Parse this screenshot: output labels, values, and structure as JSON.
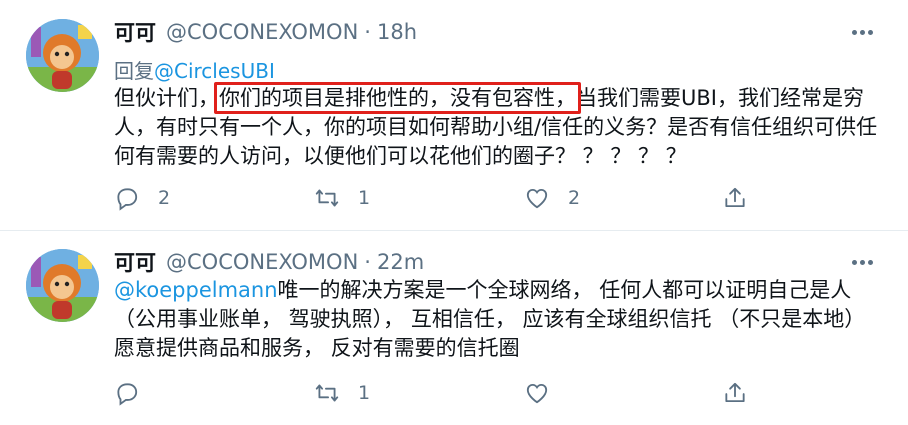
{
  "tweets": [
    {
      "name": "可可",
      "handle": "@COCONEXOMON",
      "separator": "·",
      "time": "18h",
      "reply_prefix": "回复",
      "reply_to": "@CirclesUBI",
      "text_before": "但伙计们，",
      "text_highlight": "你们的项目是排他性的，没有包容性，",
      "text_after": "当我们需要UBI，我们经常是穷人，有时只有一个人，你的项目如何帮助小组/信任的义务？是否有信任组织可供任何有需要的人访问，以便他们可以花他们的圈子？ ？ ？ ？ ？",
      "counts": {
        "reply": "2",
        "retweet": "1",
        "like": "2"
      }
    },
    {
      "name": "可可",
      "handle": "@COCONEXOMON",
      "separator": "·",
      "time": "22m",
      "mention": "@koeppelmann",
      "text": "唯一的解决方案是一个全球网络， 任何人都可以证明自己是人 （公用事业账单， 驾驶执照）， 互相信任， 应该有全球组织信托 （不只是本地） 愿意提供商品和服务， 反对有需要的信托圈",
      "counts": {
        "reply": "",
        "retweet": "1",
        "like": ""
      }
    }
  ],
  "icons": {
    "more": "more-dots-icon",
    "reply": "reply-icon",
    "retweet": "retweet-icon",
    "like": "like-icon",
    "share": "share-icon"
  },
  "colors": {
    "link": "#1b95e0",
    "secondary_text": "#5b7083",
    "highlight_box": "#e0201b"
  }
}
